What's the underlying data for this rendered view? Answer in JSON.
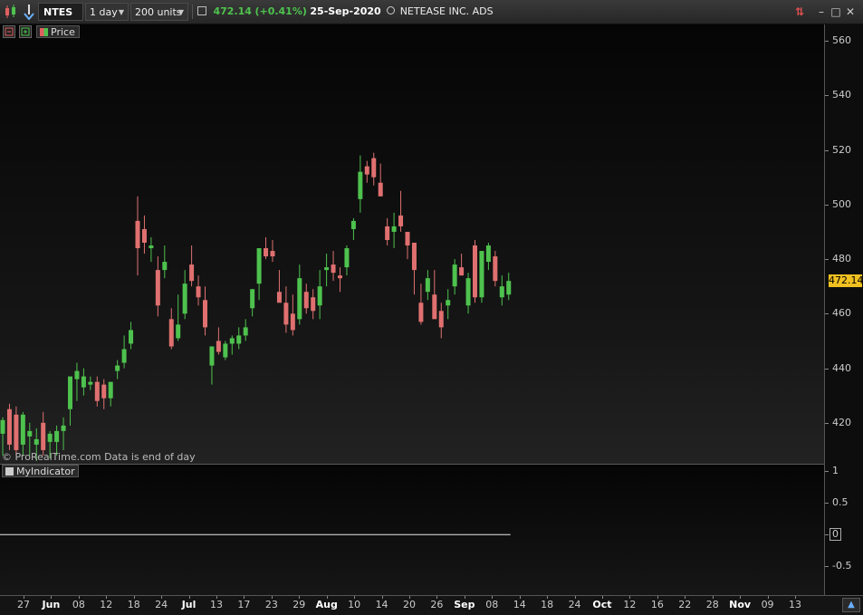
{
  "toolbar": {
    "symbol": "NTES",
    "interval": "1 day",
    "units": "200 units",
    "last_price": "472.14",
    "change": "(+0.41%)",
    "date": "25-Sep-2020",
    "instrument_name": "NETEASE INC. ADS"
  },
  "subbar": {
    "price_label": "Price"
  },
  "footer": {
    "copyright": "© ProRealTime.com   Data is end of day"
  },
  "indicator": {
    "label": "MyIndicator"
  },
  "price_axis": {
    "labels": [
      "560",
      "540",
      "520",
      "500",
      "480",
      "460",
      "440",
      "420"
    ],
    "last": "472.14"
  },
  "indicator_axis": {
    "labels": [
      "1",
      "0.5",
      "0",
      "-0.5"
    ]
  },
  "x_axis": {
    "labels": [
      {
        "t": "27",
        "m": false
      },
      {
        "t": "Jun",
        "m": true
      },
      {
        "t": "08",
        "m": false
      },
      {
        "t": "12",
        "m": false
      },
      {
        "t": "18",
        "m": false
      },
      {
        "t": "24",
        "m": false
      },
      {
        "t": "Jul",
        "m": true
      },
      {
        "t": "13",
        "m": false
      },
      {
        "t": "17",
        "m": false
      },
      {
        "t": "23",
        "m": false
      },
      {
        "t": "29",
        "m": false
      },
      {
        "t": "Aug",
        "m": true
      },
      {
        "t": "10",
        "m": false
      },
      {
        "t": "14",
        "m": false
      },
      {
        "t": "20",
        "m": false
      },
      {
        "t": "26",
        "m": false
      },
      {
        "t": "Sep",
        "m": true
      },
      {
        "t": "08",
        "m": false
      },
      {
        "t": "14",
        "m": false
      },
      {
        "t": "18",
        "m": false
      },
      {
        "t": "24",
        "m": false
      },
      {
        "t": "Oct",
        "m": true
      },
      {
        "t": "12",
        "m": false
      },
      {
        "t": "16",
        "m": false
      },
      {
        "t": "22",
        "m": false
      },
      {
        "t": "28",
        "m": false
      },
      {
        "t": "Nov",
        "m": true
      },
      {
        "t": "09",
        "m": false
      },
      {
        "t": "13",
        "m": false
      }
    ]
  },
  "colors": {
    "up": "#4ec24e",
    "down": "#e07070",
    "last_price_bg": "#f0c020",
    "indicator_line": "#e8e8e8"
  },
  "chart_data": {
    "type": "candlestick",
    "y_range": [
      405,
      566
    ],
    "candles": [
      {
        "o": 416,
        "h": 422,
        "l": 408,
        "c": 421
      },
      {
        "o": 425,
        "h": 427,
        "l": 410,
        "c": 412
      },
      {
        "o": 423,
        "h": 426,
        "l": 408,
        "c": 410
      },
      {
        "o": 412,
        "h": 424,
        "l": 408,
        "c": 423
      },
      {
        "o": 415,
        "h": 420,
        "l": 408,
        "c": 417
      },
      {
        "o": 412,
        "h": 418,
        "l": 406,
        "c": 414
      },
      {
        "o": 420,
        "h": 424,
        "l": 408,
        "c": 410
      },
      {
        "o": 413,
        "h": 417,
        "l": 407,
        "c": 416
      },
      {
        "o": 413,
        "h": 419,
        "l": 408,
        "c": 417
      },
      {
        "o": 417,
        "h": 422,
        "l": 410,
        "c": 419
      },
      {
        "o": 425,
        "h": 428,
        "l": 419,
        "c": 437
      },
      {
        "o": 436,
        "h": 442,
        "l": 428,
        "c": 439
      },
      {
        "o": 433,
        "h": 440,
        "l": 430,
        "c": 437
      },
      {
        "o": 434,
        "h": 437,
        "l": 432,
        "c": 435
      },
      {
        "o": 435,
        "h": 437,
        "l": 426,
        "c": 428
      },
      {
        "o": 434,
        "h": 436,
        "l": 425,
        "c": 429
      },
      {
        "o": 429,
        "h": 432,
        "l": 426,
        "c": 435
      },
      {
        "o": 439,
        "h": 443,
        "l": 436,
        "c": 441
      },
      {
        "o": 442,
        "h": 452,
        "l": 440,
        "c": 447
      },
      {
        "o": 449,
        "h": 457,
        "l": 447,
        "c": 454
      },
      {
        "o": 494,
        "h": 503,
        "l": 474,
        "c": 484
      },
      {
        "o": 491,
        "h": 496,
        "l": 482,
        "c": 486
      },
      {
        "o": 484,
        "h": 488,
        "l": 479,
        "c": 485
      },
      {
        "o": 476,
        "h": 481,
        "l": 459,
        "c": 463
      },
      {
        "o": 476,
        "h": 485,
        "l": 473,
        "c": 479
      },
      {
        "o": 458,
        "h": 462,
        "l": 447,
        "c": 448
      },
      {
        "o": 451,
        "h": 467,
        "l": 450,
        "c": 456
      },
      {
        "o": 460,
        "h": 476,
        "l": 458,
        "c": 471
      },
      {
        "o": 478,
        "h": 485,
        "l": 470,
        "c": 472
      },
      {
        "o": 470,
        "h": 474,
        "l": 463,
        "c": 466
      },
      {
        "o": 465,
        "h": 470,
        "l": 452,
        "c": 455
      },
      {
        "o": 441,
        "h": 447,
        "l": 434,
        "c": 448
      },
      {
        "o": 450,
        "h": 455,
        "l": 445,
        "c": 446
      },
      {
        "o": 444,
        "h": 450,
        "l": 443,
        "c": 449
      },
      {
        "o": 449,
        "h": 452,
        "l": 445,
        "c": 451
      },
      {
        "o": 449,
        "h": 455,
        "l": 447,
        "c": 452
      },
      {
        "o": 452,
        "h": 458,
        "l": 450,
        "c": 455
      },
      {
        "o": 462,
        "h": 468,
        "l": 459,
        "c": 469
      },
      {
        "o": 471,
        "h": 480,
        "l": 465,
        "c": 484
      },
      {
        "o": 484,
        "h": 488,
        "l": 480,
        "c": 481
      },
      {
        "o": 483,
        "h": 487,
        "l": 479,
        "c": 481
      },
      {
        "o": 468,
        "h": 476,
        "l": 465,
        "c": 464
      },
      {
        "o": 464,
        "h": 470,
        "l": 453,
        "c": 456
      },
      {
        "o": 460,
        "h": 467,
        "l": 452,
        "c": 454
      },
      {
        "o": 458,
        "h": 478,
        "l": 456,
        "c": 473
      },
      {
        "o": 468,
        "h": 471,
        "l": 460,
        "c": 462
      },
      {
        "o": 466,
        "h": 469,
        "l": 458,
        "c": 461
      },
      {
        "o": 463,
        "h": 476,
        "l": 458,
        "c": 470
      },
      {
        "o": 476,
        "h": 482,
        "l": 470,
        "c": 477
      },
      {
        "o": 478,
        "h": 483,
        "l": 472,
        "c": 475
      },
      {
        "o": 474,
        "h": 477,
        "l": 468,
        "c": 473
      },
      {
        "o": 477,
        "h": 485,
        "l": 474,
        "c": 484
      },
      {
        "o": 491,
        "h": 495,
        "l": 487,
        "c": 494
      },
      {
        "o": 502,
        "h": 518,
        "l": 497,
        "c": 512
      },
      {
        "o": 514,
        "h": 516,
        "l": 508,
        "c": 511
      },
      {
        "o": 517,
        "h": 519,
        "l": 507,
        "c": 510
      },
      {
        "o": 508,
        "h": 515,
        "l": 503,
        "c": 503
      },
      {
        "o": 492,
        "h": 495,
        "l": 485,
        "c": 487
      },
      {
        "o": 490,
        "h": 497,
        "l": 484,
        "c": 492
      },
      {
        "o": 496,
        "h": 505,
        "l": 490,
        "c": 492
      },
      {
        "o": 490,
        "h": 490,
        "l": 480,
        "c": 485
      },
      {
        "o": 486,
        "h": 486,
        "l": 467,
        "c": 476
      },
      {
        "o": 464,
        "h": 471,
        "l": 456,
        "c": 457
      },
      {
        "o": 468,
        "h": 476,
        "l": 465,
        "c": 473
      },
      {
        "o": 467,
        "h": 476,
        "l": 462,
        "c": 458
      },
      {
        "o": 461,
        "h": 464,
        "l": 451,
        "c": 455
      },
      {
        "o": 463,
        "h": 469,
        "l": 458,
        "c": 465
      },
      {
        "o": 470,
        "h": 480,
        "l": 467,
        "c": 478
      },
      {
        "o": 477,
        "h": 482,
        "l": 474,
        "c": 474
      },
      {
        "o": 463,
        "h": 475,
        "l": 460,
        "c": 473
      },
      {
        "o": 485,
        "h": 487,
        "l": 464,
        "c": 466
      },
      {
        "o": 466,
        "h": 482,
        "l": 464,
        "c": 483
      },
      {
        "o": 479,
        "h": 486,
        "l": 476,
        "c": 485
      },
      {
        "o": 481,
        "h": 483,
        "l": 470,
        "c": 472
      },
      {
        "o": 466,
        "h": 474,
        "l": 463,
        "c": 470
      },
      {
        "o": 467,
        "h": 475,
        "l": 465,
        "c": 472
      }
    ],
    "indicator": {
      "y_range": [
        -0.95,
        1.1
      ],
      "value": 0
    }
  }
}
